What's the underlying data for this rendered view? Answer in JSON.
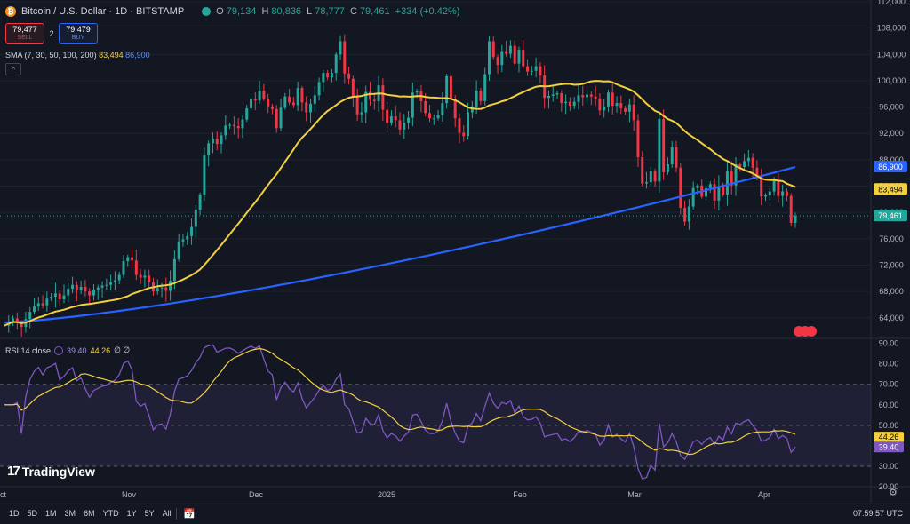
{
  "header": {
    "coin_icon": "₿",
    "title": "Bitcoin / U.S. Dollar · 1D · BITSTAMP",
    "ohlc": {
      "o_label": "O",
      "o": "79,134",
      "h_label": "H",
      "h": "80,836",
      "l_label": "L",
      "l": "78,777",
      "c_label": "C",
      "c": "79,461",
      "change": "+334 (+0.42%)"
    }
  },
  "trade": {
    "sell_price": "79,477",
    "sell_label": "SELL",
    "spread": "2",
    "buy_price": "79,479",
    "buy_label": "BUY"
  },
  "indicators": {
    "sma_label": "SMA (7, 30, 50, 100, 200)",
    "sma_value_1": "83,494",
    "sma_value_2": "86,900",
    "collapse_icon": "^",
    "rsi_label": "RSI 14 close",
    "rsi_value": "39.40",
    "rsi_ma": "44.26",
    "rsi_extra": "∅ ∅"
  },
  "logo": {
    "mark": "17",
    "text": "TradingView"
  },
  "toolbar": {
    "timeframes": [
      "1D",
      "5D",
      "1M",
      "3M",
      "6M",
      "YTD",
      "1Y",
      "5Y",
      "All"
    ],
    "calendar_icon": "📅",
    "time": "07:59:57 UTC",
    "settings_icon": "⚙"
  },
  "colors": {
    "bg": "#131722",
    "up": "#26a69a",
    "down": "#f23645",
    "sma_yellow": "#f4d03f",
    "sma_blue": "#2962ff",
    "rsi": "#7e57c2"
  },
  "chart_data": [
    {
      "type": "candlestick",
      "price_ticks": [
        64000,
        68000,
        72000,
        76000,
        80000,
        84000,
        88000,
        92000,
        96000,
        100000,
        104000,
        108000,
        112000
      ],
      "price_tick_labels": [
        "64,000",
        "68,000",
        "72,000",
        "76,000",
        "80,000",
        "84,000",
        "88,000",
        "92,000",
        "96,000",
        "100,000",
        "104,000",
        "108,000",
        "112,000"
      ],
      "ylim": [
        61000,
        112000
      ],
      "x_labels": [
        "ct",
        "Nov",
        "Dec",
        "2025",
        "Feb",
        "Mar",
        "Apr"
      ],
      "price_labels": [
        {
          "value": 86900,
          "text": "86,900",
          "color": "#2962ff"
        },
        {
          "value": 83494,
          "text": "83,494",
          "color": "#f4d03f"
        },
        {
          "value": 79461,
          "text": "79,461",
          "color": "#26a69a"
        }
      ],
      "closes": [
        62800,
        63400,
        63900,
        63200,
        62600,
        63800,
        64900,
        65700,
        66200,
        65900,
        66900,
        67200,
        67700,
        66800,
        67400,
        68400,
        69000,
        68200,
        68700,
        68000,
        67400,
        68300,
        68600,
        68900,
        69000,
        69400,
        69700,
        70500,
        72600,
        73200,
        72700,
        70500,
        70100,
        70400,
        69400,
        68000,
        68500,
        68600,
        68100,
        69600,
        72900,
        75600,
        75900,
        76400,
        77800,
        80400,
        82700,
        88700,
        90500,
        91200,
        90400,
        91700,
        93200,
        93300,
        93100,
        92800,
        94100,
        95800,
        97200,
        97000,
        98500,
        97300,
        96100,
        95700,
        92800,
        95900,
        97600,
        96700,
        96300,
        98900,
        96700,
        95200,
        96500,
        97800,
        99800,
        101200,
        100500,
        101200,
        104000,
        106000,
        101100,
        100300,
        97600,
        94900,
        95200,
        98300,
        97100,
        96900,
        99300,
        95600,
        93600,
        94600,
        94000,
        92600,
        93600,
        94400,
        98200,
        98400,
        96900,
        95100,
        94300,
        94300,
        94800,
        96600,
        100700,
        97200,
        94300,
        92100,
        91600,
        95200,
        96100,
        98500,
        96900,
        101000,
        106000,
        103600,
        102400,
        104500,
        104100,
        105300,
        102600,
        104700,
        102200,
        101400,
        101500,
        102200,
        100800,
        97400,
        97700,
        97900,
        98100,
        96600,
        96800,
        96200,
        96800,
        97800,
        97500,
        97900,
        97600,
        97300,
        95500,
        96100,
        98200,
        96200,
        96600,
        95800,
        95300,
        96400,
        94000,
        88400,
        84400,
        84600,
        86300,
        84700,
        94200,
        86100,
        87300,
        89900,
        86800,
        80700,
        78600,
        80900,
        83700,
        84100,
        82400,
        83700,
        84300,
        81800,
        84000,
        82700,
        86300,
        84100,
        87300,
        86900,
        87800,
        88300,
        86800,
        85400,
        82400,
        82600,
        83200,
        85000,
        82500,
        83200,
        82500,
        78400,
        79461
      ],
      "sma_yellow_legend": "83,494",
      "sma_blue_legend": "86,900"
    },
    {
      "type": "line",
      "name": "RSI 14 close",
      "ylim": [
        20,
        92
      ],
      "ticks": [
        20,
        30,
        40,
        50,
        60,
        70,
        80,
        90
      ],
      "tick_labels": [
        "20.00",
        "30.00",
        "40.00",
        "50.00",
        "60.00",
        "70.00",
        "80.00",
        "90.00"
      ],
      "band": [
        30,
        70
      ],
      "value_labels": [
        {
          "value": 44.26,
          "text": "44.26",
          "color": "#f4d03f"
        },
        {
          "value": 39.4,
          "text": "39.40",
          "color": "#7e57c2"
        }
      ]
    }
  ]
}
